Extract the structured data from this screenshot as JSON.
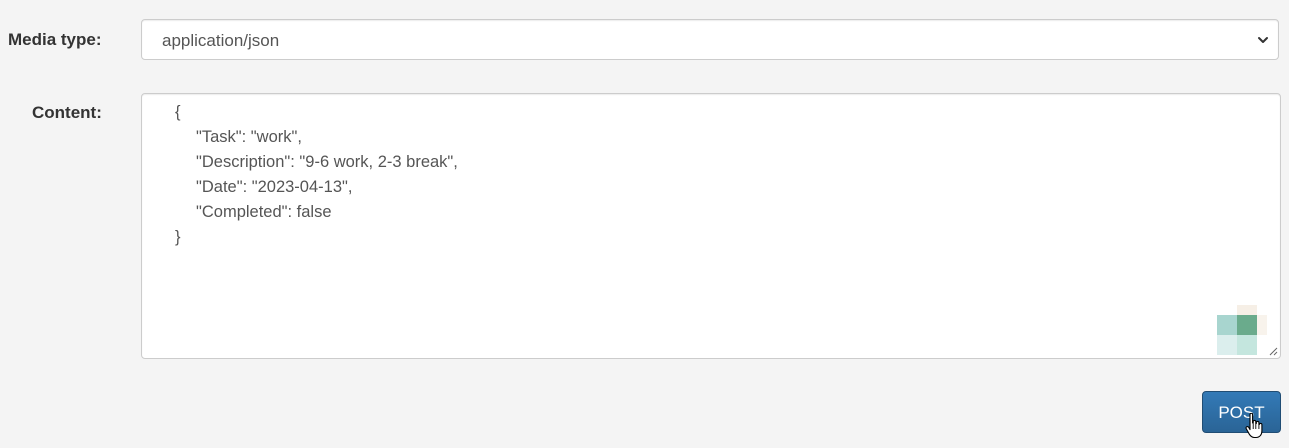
{
  "form": {
    "media_type_label": "Media type:",
    "content_label": "Content:",
    "media_type_value": "application/json",
    "content_lines": [
      "{",
      "\"Task\": \"work\",",
      "\"Description\": \"9-6 work, 2-3 break\",",
      "\"Date\": \"2023-04-13\",",
      "\"Completed\": false",
      "}"
    ],
    "post_label": "POST"
  },
  "icons": {
    "select_arrow": "chevron-down-icon",
    "resize": "resize-handle-icon",
    "cursor": "hand-pointer-icon"
  },
  "colors": {
    "page_background": "#f4f4f4",
    "button_primary": "#2e6da4",
    "button_text": "#ffffff",
    "input_border": "#cccccc",
    "text": "#333333"
  }
}
